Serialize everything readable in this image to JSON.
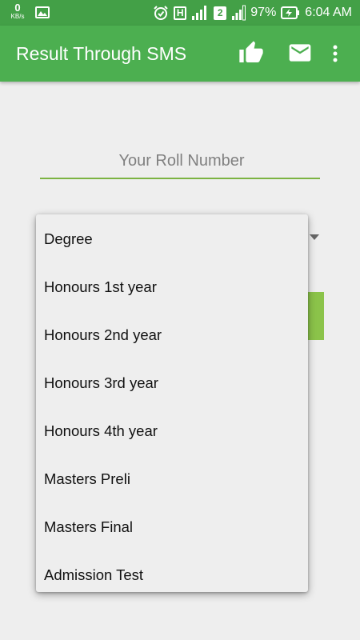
{
  "status_bar": {
    "kb_value": "0",
    "kb_unit": "KB/s",
    "network_type": "H",
    "sim_badge": "2",
    "battery": "97%",
    "time": "6:04 AM"
  },
  "toolbar": {
    "title": "Result Through SMS"
  },
  "roll_input": {
    "placeholder": "Your Roll Number",
    "value": ""
  },
  "dropdown": {
    "items": [
      "Degree",
      "Honours 1st year",
      "Honours 2nd year",
      "Honours 3rd year",
      "Honours 4th year",
      "Masters Preli",
      "Masters Final",
      "Admission Test"
    ]
  },
  "colors": {
    "status_bar": "#43a047",
    "toolbar": "#4caf50",
    "accent_line": "#7cb342",
    "button": "#8bc34a",
    "background": "#eeeeee"
  }
}
